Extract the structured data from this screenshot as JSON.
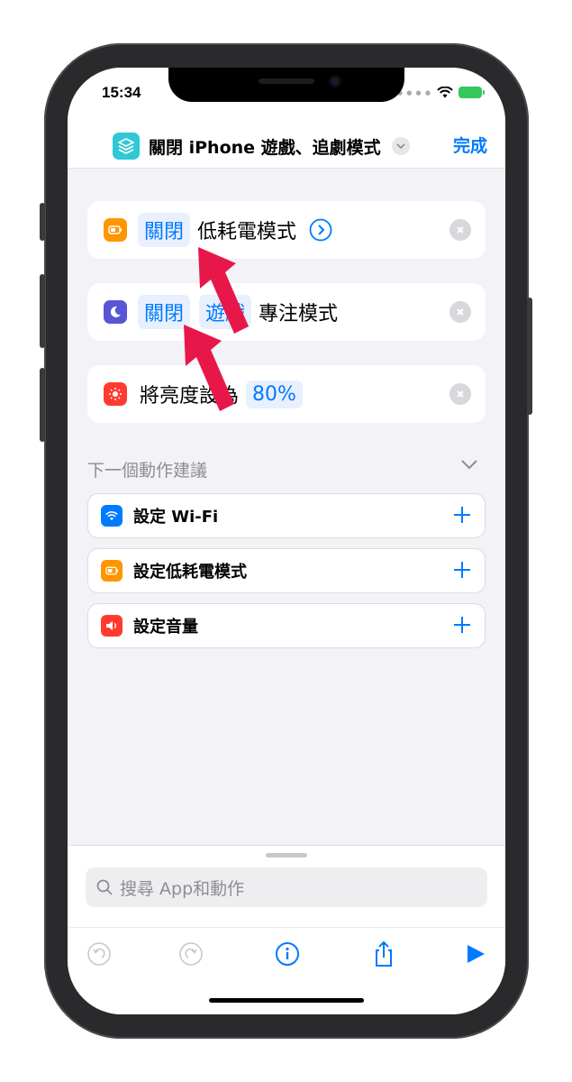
{
  "status": {
    "time": "15:34"
  },
  "header": {
    "title": "關閉 iPhone 遊戲、追劇模式",
    "done_label": "完成"
  },
  "actions": [
    {
      "token": "關閉",
      "text": "低耗電模式",
      "icon": "battery-icon",
      "color": "#ff9500"
    },
    {
      "token": "關閉",
      "token2": "遊戲",
      "text": "專注模式",
      "icon": "moon-icon",
      "color": "#5856d6"
    },
    {
      "text": "將亮度設為",
      "token": "80%",
      "icon": "sun-icon",
      "color": "#ff3b30"
    }
  ],
  "suggestions": {
    "title": "下一個動作建議",
    "items": [
      {
        "label": "設定 Wi-Fi",
        "icon": "wifi-icon",
        "color": "#007aff"
      },
      {
        "label": "設定低耗電模式",
        "icon": "battery-icon",
        "color": "#ff9500"
      },
      {
        "label": "設定音量",
        "icon": "speaker-icon",
        "color": "#ff3b30"
      }
    ]
  },
  "search": {
    "placeholder": "搜尋 App和動作"
  },
  "colors": {
    "accent": "#007aff",
    "arrow": "#e8174a"
  }
}
